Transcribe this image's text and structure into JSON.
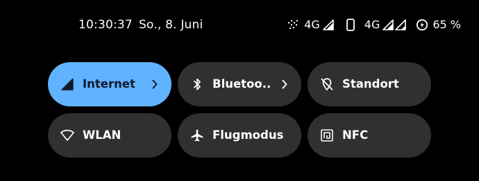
{
  "status_bar": {
    "time": "10:30:37",
    "date": "So., 8. Juni",
    "sim1_network": "4G",
    "sim2_network": "4G",
    "battery_percent": "65 %",
    "icons": [
      "data-saver-icon",
      "signal-icon",
      "phone-icon",
      "signal-icon",
      "signal-icon",
      "battery-saver-icon"
    ]
  },
  "quick_settings": {
    "tiles": [
      {
        "label": "Internet",
        "icon": "cellular-signal-icon",
        "active": true,
        "has_chevron": true
      },
      {
        "label": "Bluetoo..",
        "icon": "bluetooth-icon",
        "active": false,
        "has_chevron": true
      },
      {
        "label": "Standort",
        "icon": "location-off-icon",
        "active": false,
        "has_chevron": false
      },
      {
        "label": "WLAN",
        "icon": "wifi-icon",
        "active": false,
        "has_chevron": false
      },
      {
        "label": "Flugmodus",
        "icon": "airplane-icon",
        "active": false,
        "has_chevron": false
      },
      {
        "label": "NFC",
        "icon": "nfc-icon",
        "active": false,
        "has_chevron": false
      }
    ]
  },
  "colors": {
    "background": "#000000",
    "tile_inactive": "#303032",
    "tile_active": "#62b3ff",
    "text_active": "#0d1b2a",
    "text": "#ffffff"
  }
}
